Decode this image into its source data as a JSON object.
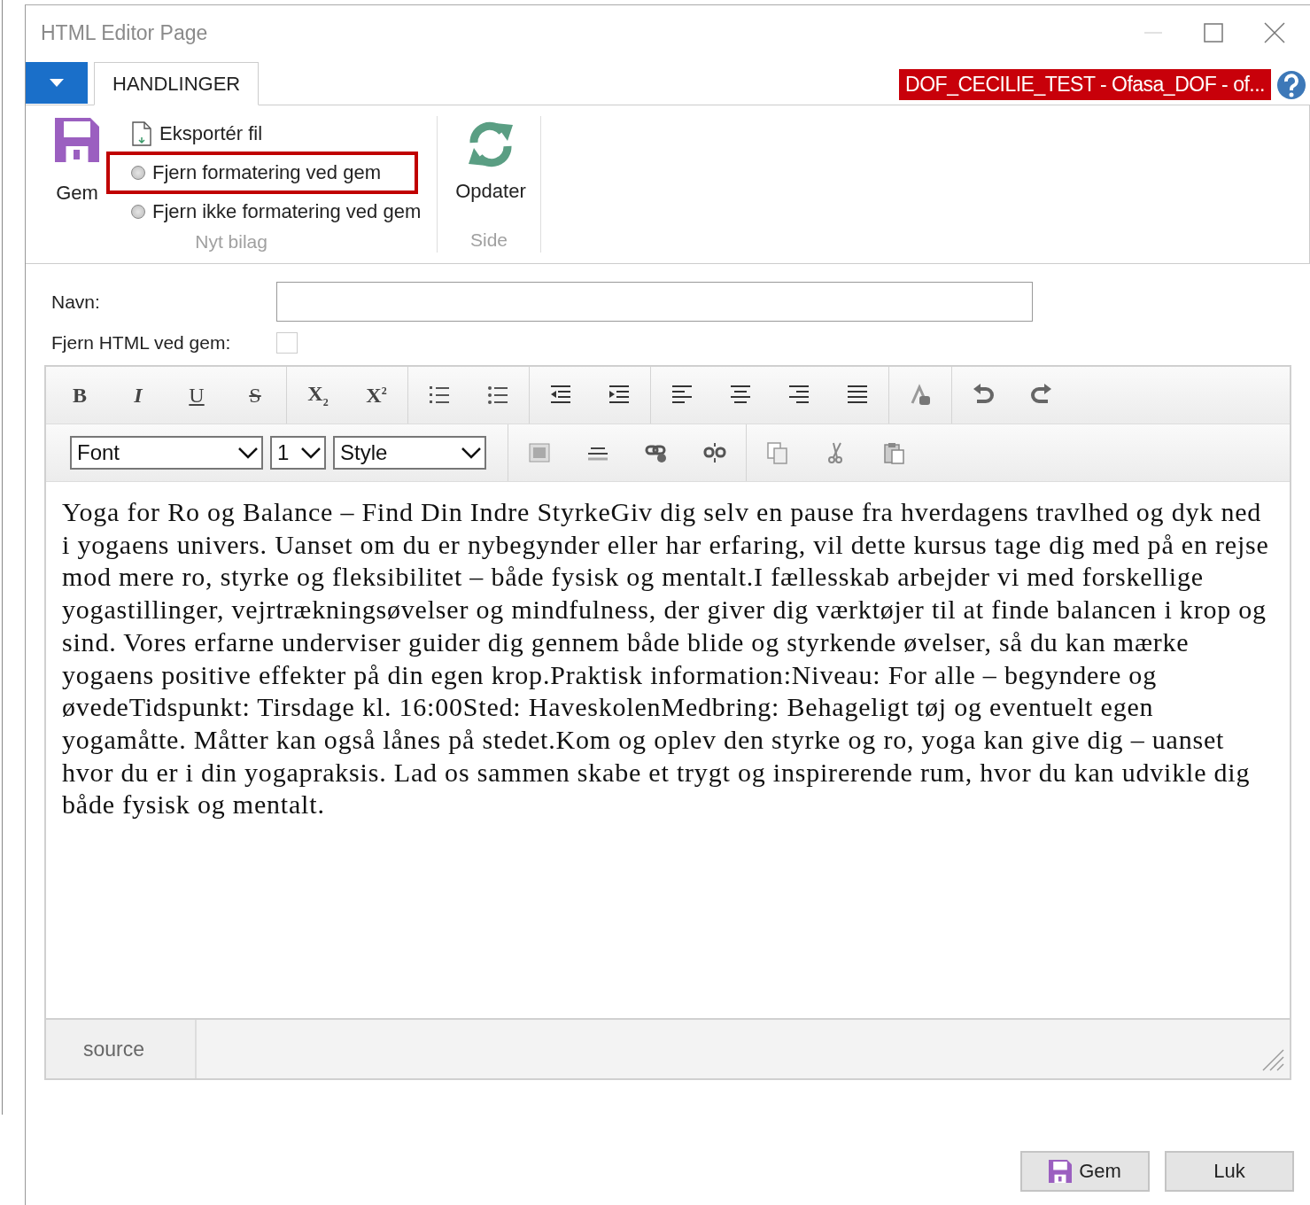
{
  "window": {
    "title": "HTML Editor Page"
  },
  "ribbon": {
    "tabs": [
      {
        "label": "HANDLINGER",
        "selected": true
      }
    ],
    "context_badge": "DOF_CECILIE_TEST - Ofasa_DOF - of...",
    "groups": [
      {
        "label": "Nyt bilag",
        "large_button": {
          "label": "Gem",
          "kind": "save"
        },
        "items": [
          {
            "kind": "command",
            "label": "Eksportér fil"
          },
          {
            "kind": "radio",
            "label": "Fjern formatering ved gem",
            "selected": false,
            "highlighted": true
          },
          {
            "kind": "radio",
            "label": "Fjern ikke formatering ved gem",
            "selected": false,
            "highlighted": false
          }
        ]
      },
      {
        "label": "Side",
        "large_button": {
          "label": "Opdater",
          "kind": "refresh"
        }
      }
    ]
  },
  "form": {
    "name_field": {
      "label": "Navn:"
    },
    "strip_html": {
      "label": "Fjern HTML ved gem:",
      "checked": false
    }
  },
  "editor": {
    "toolbar_rows": [
      [
        [
          {
            "kind": "bold",
            "label": "B"
          },
          {
            "kind": "italic",
            "label": "I"
          },
          {
            "kind": "underline",
            "label": "U"
          },
          {
            "kind": "strike",
            "label": "S"
          }
        ],
        [
          {
            "kind": "subscript",
            "label": "X$_{2}$"
          },
          {
            "kind": "superscript",
            "label": "X$^{2}$"
          }
        ],
        [
          {
            "kind": "ordered-list"
          },
          {
            "kind": "bullet-list"
          }
        ],
        [
          {
            "kind": "outdent"
          },
          {
            "kind": "indent"
          }
        ],
        [
          {
            "kind": "align-left"
          },
          {
            "kind": "align-center"
          },
          {
            "kind": "align-right"
          },
          {
            "kind": "justify"
          }
        ],
        [
          {
            "kind": "remove-format"
          }
        ],
        [
          {
            "kind": "undo"
          },
          {
            "kind": "redo"
          }
        ]
      ],
      [
        [
          {
            "kind": "select",
            "value": "Font"
          },
          {
            "kind": "select",
            "value": "1"
          },
          {
            "kind": "select",
            "value": "Style"
          }
        ],
        [
          {
            "kind": "image"
          },
          {
            "kind": "rule"
          },
          {
            "kind": "link"
          },
          {
            "kind": "unlink"
          }
        ],
        [
          {
            "kind": "copy"
          },
          {
            "kind": "cut"
          },
          {
            "kind": "paste"
          }
        ]
      ]
    ],
    "content": "Yoga for Ro og Balance – Find Din Indre StyrkeGiv dig selv en pause fra hverdagens travlhed og dyk ned i yogaens univers. Uanset om du er nybegynder eller har erfaring, vil dette kursus tage dig med på en rejse mod mere ro, styrke og fleksibilitet – både fysisk og mentalt.I fællesskab arbejder vi med forskellige yogastillinger, vejrtrækningsøvelser og mindfulness, der giver dig værktøjer til at finde balancen i krop og sind. Vores erfarne underviser guider dig gennem både blide og styrkende øvelser, så du kan mærke yogaens positive effekter på din egen krop.Praktisk information:Niveau: For alle – begyndere og øvedeTidspunkt: Tirsdage kl. 16:00Sted: HaveskolenMedbring: Behageligt tøj og eventuelt egen yogamåtte. Måtter kan også lånes på stedet.Kom og oplev den styrke og ro, yoga kan give dig – uanset hvor du er i din yogapraksis. Lad os sammen skabe et trygt og inspirerende rum, hvor du kan udvikle dig både fysisk og mentalt.",
    "source_tab": "source"
  },
  "buttons": [
    {
      "label": "Gem",
      "kind": "save"
    },
    {
      "label": "Luk",
      "kind": "plain"
    }
  ]
}
